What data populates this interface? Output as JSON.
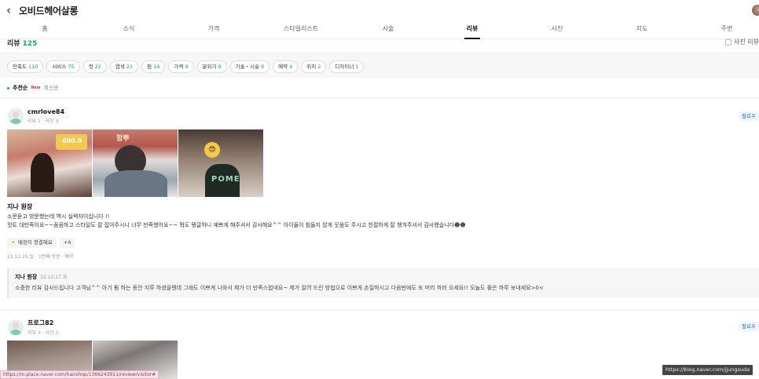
{
  "header": {
    "title": "오비드헤어살롱"
  },
  "tabs": [
    {
      "label": "홈"
    },
    {
      "label": "소식"
    },
    {
      "label": "가격"
    },
    {
      "label": "스타일리스트"
    },
    {
      "label": "시술"
    },
    {
      "label": "리뷰"
    },
    {
      "label": "사진"
    },
    {
      "label": "지도"
    },
    {
      "label": "주변"
    }
  ],
  "active_tab": "리뷰",
  "review_header": {
    "label": "리뷰",
    "count": "125",
    "photo_only_label": "사진 리뷰"
  },
  "filters": [
    {
      "label": "만족도",
      "count": "110"
    },
    {
      "label": "서비스",
      "count": "75"
    },
    {
      "label": "컷",
      "count": "22"
    },
    {
      "label": "염색",
      "count": "21"
    },
    {
      "label": "펌",
      "count": "14"
    },
    {
      "label": "가격",
      "count": "9"
    },
    {
      "label": "분위기",
      "count": "9"
    },
    {
      "label": "기술・시술",
      "count": "9"
    },
    {
      "label": "예약",
      "count": "4"
    },
    {
      "label": "위치",
      "count": "2"
    },
    {
      "label": "디자이너",
      "count": "1"
    }
  ],
  "sort": {
    "recommended": "추천순",
    "new_badge": "New",
    "latest": "최신순"
  },
  "reviews": [
    {
      "user": "cmrlove84",
      "meta": "리뷰 1 · 사진 3",
      "follow": "팔로우",
      "photo_text_1": "000.0",
      "photo_text_2": "함뿌",
      "photo_text_3": "POME",
      "designer": "지나 원장",
      "line1": "소문듣고 방문했는데 역시 실력자이십니다 !!",
      "line2": "컷트 대만족이요~~꼼꼼하고 스타일도 잘 잡아주시니 너무 만족했어요~~ 뭐도 탱글하니 예쁘게 해주셔서 감사해요^^ 아이들이 힘들지 않게 웃음도 주시고 친절하게 잘 챙겨주셔서 감사했습니다☻☻",
      "tag": "매장이 청결해요",
      "tag_more": "+4",
      "visit": "22.12.25.일 · 1번째 방문 · 예약",
      "reply": {
        "author": "지나 원장",
        "date": "22.12.27.화",
        "text": "소중한 리뷰 감사드립니다 고객님^^ 아기 펌 하는 동안 지루 하셨을텐데 그래도 이쁘게 나와서 제가 더 만족스럽네요~ 제가 알려 드린 방법으로 이쁘게 손질하시고 다음번에도 또 머리 하러 오세요!! 오늘도 좋은 하루 보내세요>0<"
      }
    },
    {
      "user": "프로그82",
      "meta": "리뷰 3 · 사진 3",
      "follow": "팔로우"
    }
  ],
  "status_url": "https://m.place.naver.com/hairshop/1366243911/review/visitor#",
  "tooltip": "https://blog.naver.com/jjungsuda"
}
